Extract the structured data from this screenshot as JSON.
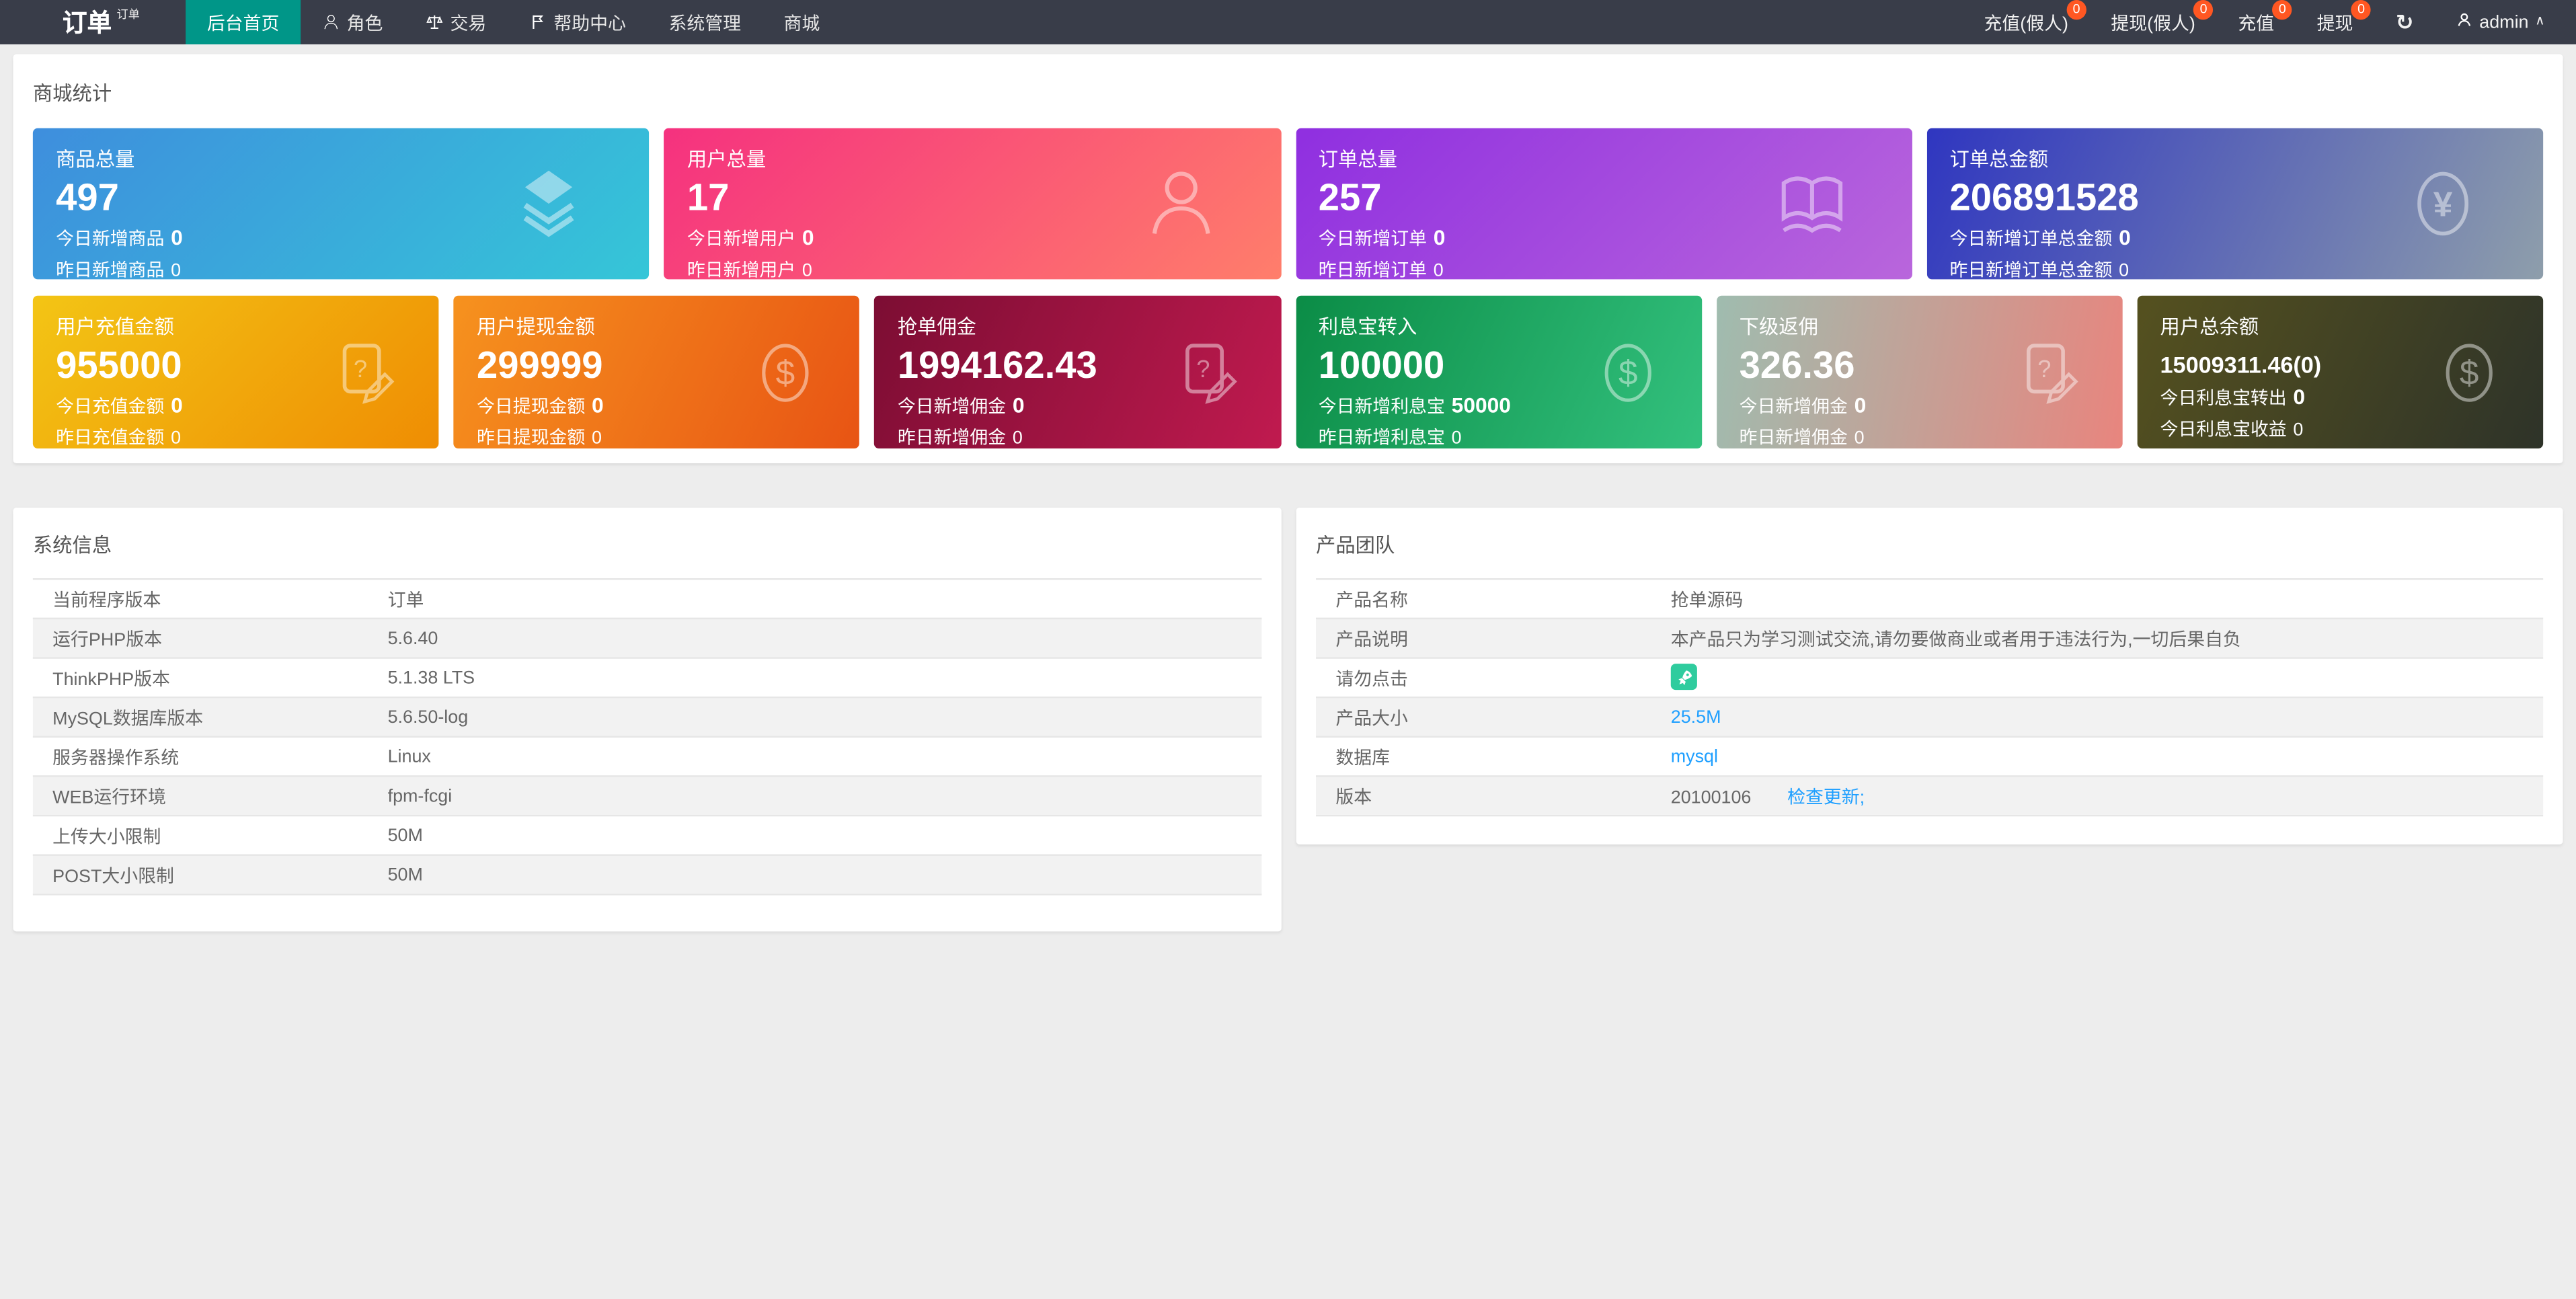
{
  "navbar": {
    "brand": "订单",
    "brand_sup": "订单",
    "menu": [
      {
        "label": "后台首页",
        "active": true,
        "icon": null
      },
      {
        "label": "角色",
        "active": false,
        "icon": "person-icon"
      },
      {
        "label": "交易",
        "active": false,
        "icon": "scales-icon"
      },
      {
        "label": "帮助中心",
        "active": false,
        "icon": "flag-icon"
      },
      {
        "label": "系统管理",
        "active": false,
        "icon": null
      },
      {
        "label": "商城",
        "active": false,
        "icon": null
      }
    ],
    "quick_actions": [
      {
        "label": "充值(假人)",
        "badge": "0"
      },
      {
        "label": "提现(假人)",
        "badge": "0"
      },
      {
        "label": "充值",
        "badge": "0"
      },
      {
        "label": "提现",
        "badge": "0"
      }
    ],
    "refresh_icon": "↻",
    "admin": {
      "name": "admin",
      "caret": "∧"
    },
    "colors": {
      "bar_bg": "#393D49",
      "active_bg": "#009688",
      "badge_bg": "#FF5722"
    }
  },
  "stats": {
    "section_title": "商城统计",
    "cards_row1": [
      {
        "title": "商品总量",
        "value": "497",
        "line1_label": "今日新增商品",
        "line1_value": "0",
        "line2_label": "昨日新增商品",
        "line2_value": "0",
        "icon": "layers-icon",
        "gradient": [
          "#3E8EDD",
          "#35C6D8"
        ],
        "angle": "135deg"
      },
      {
        "title": "用户总量",
        "value": "17",
        "line1_label": "今日新增用户",
        "line1_value": "0",
        "line2_label": "昨日新增用户",
        "line2_value": "0",
        "icon": "person-icon",
        "gradient": [
          "#F5317F",
          "#FF7E6B"
        ],
        "angle": "135deg"
      },
      {
        "title": "订单总量",
        "value": "257",
        "line1_label": "今日新增订单",
        "line1_value": "0",
        "line2_label": "昨日新增订单",
        "line2_value": "0",
        "icon": "book-icon",
        "gradient": [
          "#8F2FE0",
          "#B966DC"
        ],
        "angle": "135deg"
      },
      {
        "title": "订单总金额",
        "value": "206891528",
        "line1_label": "今日新增订单总金额",
        "line1_value": "0",
        "line2_label": "昨日新增订单总金额",
        "line2_value": "0",
        "icon": "yen-circle-icon",
        "gradient": [
          "#2F36C0",
          "#8E9EAB"
        ],
        "angle": "115deg"
      }
    ],
    "cards_row2": [
      {
        "title": "用户充值金额",
        "value": "955000",
        "line1_label": "今日充值金额",
        "line1_value": "0",
        "line2_label": "昨日充值金额",
        "line2_value": "0",
        "icon": "doc-edit-icon",
        "gradient": [
          "#F3C515",
          "#EF8D03"
        ],
        "angle": "135deg"
      },
      {
        "title": "用户提现金额",
        "value": "299999",
        "line1_label": "今日提现金额",
        "line1_value": "0",
        "line2_label": "昨日提现金额",
        "line2_value": "0",
        "icon": "dollar-circle-icon",
        "gradient": [
          "#F6921E",
          "#E85414"
        ],
        "angle": "115deg"
      },
      {
        "title": "抢单佣金",
        "value": "1994162.43",
        "line1_label": "今日新增佣金",
        "line1_value": "0",
        "line2_label": "昨日新增佣金",
        "line2_value": "0",
        "icon": "doc-edit-icon",
        "gradient": [
          "#7C0D33",
          "#C01A4F"
        ],
        "angle": "115deg"
      },
      {
        "title": "利息宝转入",
        "value": "100000",
        "line1_label": "今日新增利息宝",
        "line1_value": "50000",
        "line2_label": "昨日新增利息宝",
        "line2_value": "0",
        "icon": "dollar-circle-icon",
        "gradient": [
          "#0B8C46",
          "#33C17E"
        ],
        "angle": "115deg"
      },
      {
        "title": "下级返佣",
        "value": "326.36",
        "line1_label": "今日新增佣金",
        "line1_value": "0",
        "line2_label": "昨日新增佣金",
        "line2_value": "0",
        "icon": "doc-edit-icon",
        "gradient": [
          "#9FBCAF",
          "#E8857E"
        ],
        "angle": "100deg"
      },
      {
        "title": "用户总余额",
        "value": "15009311.46(0)",
        "small_value": true,
        "line1_label": "今日利息宝转出",
        "line1_value": "0",
        "line2_label": "今日利息宝收益",
        "line2_value": "0",
        "icon": "dollar-circle-icon",
        "gradient": [
          "#55511F",
          "#2E3329"
        ],
        "angle": "115deg"
      }
    ]
  },
  "system_info": {
    "title": "系统信息",
    "rows": [
      [
        "当前程序版本",
        "订单"
      ],
      [
        "运行PHP版本",
        "5.6.40"
      ],
      [
        "ThinkPHP版本",
        "5.1.38 LTS"
      ],
      [
        "MySQL数据库版本",
        "5.6.50-log"
      ],
      [
        "服务器操作系统",
        "Linux"
      ],
      [
        "WEB运行环境",
        "fpm-fcgi"
      ],
      [
        "上传大小限制",
        "50M"
      ],
      [
        "POST大小限制",
        "50M"
      ]
    ]
  },
  "product_team": {
    "title": "产品团队",
    "link_color": "#1E9FFF",
    "rocket_bg": "#2FCC9E",
    "rows": [
      {
        "label": "产品名称",
        "type": "text",
        "value": "抢单源码"
      },
      {
        "label": "产品说明",
        "type": "text",
        "value": "本产品只为学习测试交流,请勿要做商业或者用于违法行为,一切后果自负"
      },
      {
        "label": "请勿点击",
        "type": "icon",
        "icon": "rocket-icon"
      },
      {
        "label": "产品大小",
        "type": "link",
        "value": "25.5M"
      },
      {
        "label": "数据库",
        "type": "link",
        "value": "mysql"
      },
      {
        "label": "版本",
        "type": "version",
        "value": "20100106",
        "link": "检查更新;"
      }
    ]
  }
}
